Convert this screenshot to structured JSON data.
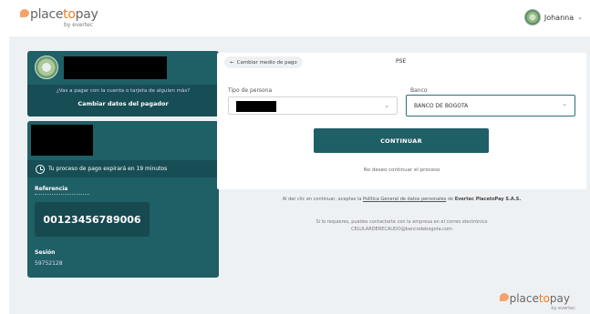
{
  "brand": {
    "name_pre": "place",
    "name_to": "to",
    "name_post": "pay",
    "sub": "by evertec"
  },
  "user": {
    "name": "Johanna"
  },
  "payer": {
    "question": "¿Vas a pagar con la cuenta o tarjeta de alguien más?",
    "change_link": "Cambiar datos del pagador"
  },
  "info": {
    "expire_text": "Tu proceso de pago expirará en 19 minutos",
    "reference_label": "Referencia",
    "reference_value": "00123456789006",
    "session_label": "Sesión",
    "session_value": "59752128"
  },
  "form": {
    "change_method": "Cambiar medio de pago",
    "method": "PSE",
    "tipo_label": "Tipo de persona",
    "banco_label": "Banco",
    "banco_value": "BANCO DE BOGOTA",
    "continue_label": "CONTINUAR",
    "no_continue": "No deseo continuar el proceso"
  },
  "legal": {
    "pre": "Al dar clic en continuar, aceptas la",
    "link": "Política General de datos personales",
    "mid": "de",
    "company": "Evertec PlacetoPay S.A.S."
  },
  "contact": {
    "line1": "Si lo requieres, puedes contactarte con la empresa en el correo electrónico",
    "line2": "CELULARDERECAUDO@bancodebogota.com"
  }
}
